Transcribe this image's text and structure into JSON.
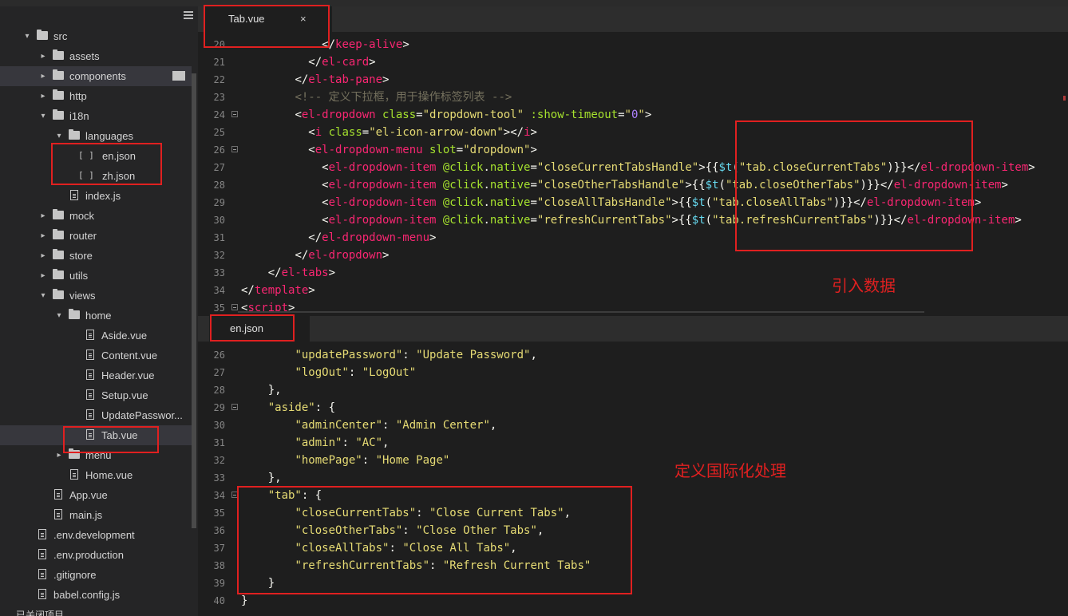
{
  "sidebar": {
    "items": [
      {
        "label": "src",
        "indent": 0,
        "type": "folder",
        "open": true
      },
      {
        "label": "assets",
        "indent": 1,
        "type": "folder",
        "open": false
      },
      {
        "label": "components",
        "indent": 1,
        "type": "folder",
        "open": false,
        "highlighted": true
      },
      {
        "label": "http",
        "indent": 1,
        "type": "folder",
        "open": false
      },
      {
        "label": "i18n",
        "indent": 1,
        "type": "folder",
        "open": true
      },
      {
        "label": "languages",
        "indent": 2,
        "type": "folder",
        "open": true
      },
      {
        "label": "en.json",
        "indent": 3,
        "type": "json"
      },
      {
        "label": "zh.json",
        "indent": 3,
        "type": "json"
      },
      {
        "label": "index.js",
        "indent": 2,
        "type": "file"
      },
      {
        "label": "mock",
        "indent": 1,
        "type": "folder",
        "open": false
      },
      {
        "label": "router",
        "indent": 1,
        "type": "folder",
        "open": false
      },
      {
        "label": "store",
        "indent": 1,
        "type": "folder",
        "open": false
      },
      {
        "label": "utils",
        "indent": 1,
        "type": "folder",
        "open": false
      },
      {
        "label": "views",
        "indent": 1,
        "type": "folder",
        "open": true
      },
      {
        "label": "home",
        "indent": 2,
        "type": "folder",
        "open": true
      },
      {
        "label": "Aside.vue",
        "indent": 3,
        "type": "file"
      },
      {
        "label": "Content.vue",
        "indent": 3,
        "type": "file"
      },
      {
        "label": "Header.vue",
        "indent": 3,
        "type": "file"
      },
      {
        "label": "Setup.vue",
        "indent": 3,
        "type": "file"
      },
      {
        "label": "UpdatePasswor...",
        "indent": 3,
        "type": "file"
      },
      {
        "label": "Tab.vue",
        "indent": 3,
        "type": "file",
        "selected": true
      },
      {
        "label": "menu",
        "indent": 2,
        "type": "folder",
        "open": false
      },
      {
        "label": "Home.vue",
        "indent": 2,
        "type": "file"
      },
      {
        "label": "App.vue",
        "indent": 1,
        "type": "file"
      },
      {
        "label": "main.js",
        "indent": 1,
        "type": "file"
      },
      {
        "label": ".env.development",
        "indent": 0,
        "type": "file"
      },
      {
        "label": ".env.production",
        "indent": 0,
        "type": "file"
      },
      {
        "label": ".gitignore",
        "indent": 0,
        "type": "file"
      },
      {
        "label": "babel.config.js",
        "indent": 0,
        "type": "file"
      }
    ],
    "footer": "已关闭项目"
  },
  "editor1": {
    "tab_label": "Tab.vue",
    "close_glyph": "×",
    "lines": [
      {
        "n": "20",
        "fold": false,
        "parts": [
          [
            "            ",
            "pun"
          ],
          [
            "</",
            "pun"
          ],
          [
            "keep-alive",
            "tag"
          ],
          [
            ">",
            "pun"
          ]
        ]
      },
      {
        "n": "21",
        "fold": false,
        "parts": [
          [
            "          ",
            "pun"
          ],
          [
            "</",
            "pun"
          ],
          [
            "el-card",
            "tag"
          ],
          [
            ">",
            "pun"
          ]
        ]
      },
      {
        "n": "22",
        "fold": false,
        "parts": [
          [
            "        ",
            "pun"
          ],
          [
            "</",
            "pun"
          ],
          [
            "el-tab-pane",
            "tag"
          ],
          [
            ">",
            "pun"
          ]
        ]
      },
      {
        "n": "23",
        "fold": false,
        "parts": [
          [
            "        ",
            "pun"
          ],
          [
            "<!-- 定义下拉框，用于操作标签列表 -->",
            "cm"
          ]
        ]
      },
      {
        "n": "24",
        "fold": true,
        "parts": [
          [
            "        ",
            "pun"
          ],
          [
            "<",
            "pun"
          ],
          [
            "el-dropdown",
            "tag"
          ],
          [
            " class",
            "attr"
          ],
          [
            "=",
            "pun"
          ],
          [
            "\"dropdown-tool\"",
            "str"
          ],
          [
            " :show-timeout",
            "attr"
          ],
          [
            "=",
            "pun"
          ],
          [
            "\"",
            "str"
          ],
          [
            "0",
            "num"
          ],
          [
            "\"",
            "str"
          ],
          [
            ">",
            "pun"
          ]
        ]
      },
      {
        "n": "25",
        "fold": false,
        "parts": [
          [
            "          ",
            "pun"
          ],
          [
            "<",
            "pun"
          ],
          [
            "i",
            "tag"
          ],
          [
            " class",
            "attr"
          ],
          [
            "=",
            "pun"
          ],
          [
            "\"el-icon-arrow-down\"",
            "str"
          ],
          [
            "></",
            "pun"
          ],
          [
            "i",
            "tag"
          ],
          [
            ">",
            "pun"
          ]
        ]
      },
      {
        "n": "26",
        "fold": true,
        "parts": [
          [
            "          ",
            "pun"
          ],
          [
            "<",
            "pun"
          ],
          [
            "el-dropdown-menu",
            "tag"
          ],
          [
            " slot",
            "attr"
          ],
          [
            "=",
            "pun"
          ],
          [
            "\"dropdown\"",
            "str"
          ],
          [
            ">",
            "pun"
          ]
        ]
      },
      {
        "n": "27",
        "fold": false,
        "parts": [
          [
            "            ",
            "pun"
          ],
          [
            "<",
            "pun"
          ],
          [
            "el-dropdown-item",
            "tag"
          ],
          [
            " @click",
            "attr"
          ],
          [
            ".",
            "pun"
          ],
          [
            "native",
            "attr"
          ],
          [
            "=",
            "pun"
          ],
          [
            "\"closeCurrentTabsHandle\"",
            "str"
          ],
          [
            ">{{",
            "pun"
          ],
          [
            "$t",
            "fn"
          ],
          [
            "(",
            "pun"
          ],
          [
            "\"tab.closeCurrentTabs\"",
            "str"
          ],
          [
            ")}}</",
            "pun"
          ],
          [
            "el-dropdown-item",
            "tag"
          ],
          [
            ">",
            "pun"
          ]
        ]
      },
      {
        "n": "28",
        "fold": false,
        "parts": [
          [
            "            ",
            "pun"
          ],
          [
            "<",
            "pun"
          ],
          [
            "el-dropdown-item",
            "tag"
          ],
          [
            " @click",
            "attr"
          ],
          [
            ".",
            "pun"
          ],
          [
            "native",
            "attr"
          ],
          [
            "=",
            "pun"
          ],
          [
            "\"closeOtherTabsHandle\"",
            "str"
          ],
          [
            ">{{",
            "pun"
          ],
          [
            "$t",
            "fn"
          ],
          [
            "(",
            "pun"
          ],
          [
            "\"tab.closeOtherTabs\"",
            "str"
          ],
          [
            ")}}</",
            "pun"
          ],
          [
            "el-dropdown-item",
            "tag"
          ],
          [
            ">",
            "pun"
          ]
        ]
      },
      {
        "n": "29",
        "fold": false,
        "parts": [
          [
            "            ",
            "pun"
          ],
          [
            "<",
            "pun"
          ],
          [
            "el-dropdown-item",
            "tag"
          ],
          [
            " @click",
            "attr"
          ],
          [
            ".",
            "pun"
          ],
          [
            "native",
            "attr"
          ],
          [
            "=",
            "pun"
          ],
          [
            "\"closeAllTabsHandle\"",
            "str"
          ],
          [
            ">{{",
            "pun"
          ],
          [
            "$t",
            "fn"
          ],
          [
            "(",
            "pun"
          ],
          [
            "\"tab.closeAllTabs\"",
            "str"
          ],
          [
            ")}}</",
            "pun"
          ],
          [
            "el-dropdown-item",
            "tag"
          ],
          [
            ">",
            "pun"
          ]
        ]
      },
      {
        "n": "30",
        "fold": false,
        "parts": [
          [
            "            ",
            "pun"
          ],
          [
            "<",
            "pun"
          ],
          [
            "el-dropdown-item",
            "tag"
          ],
          [
            " @click",
            "attr"
          ],
          [
            ".",
            "pun"
          ],
          [
            "native",
            "attr"
          ],
          [
            "=",
            "pun"
          ],
          [
            "\"refreshCurrentTabs\"",
            "str"
          ],
          [
            ">{{",
            "pun"
          ],
          [
            "$t",
            "fn"
          ],
          [
            "(",
            "pun"
          ],
          [
            "\"tab.refreshCurrentTabs\"",
            "str"
          ],
          [
            ")}}</",
            "pun"
          ],
          [
            "el-dropdown-item",
            "tag"
          ],
          [
            ">",
            "pun"
          ]
        ]
      },
      {
        "n": "31",
        "fold": false,
        "parts": [
          [
            "          ",
            "pun"
          ],
          [
            "</",
            "pun"
          ],
          [
            "el-dropdown-menu",
            "tag"
          ],
          [
            ">",
            "pun"
          ]
        ]
      },
      {
        "n": "32",
        "fold": false,
        "parts": [
          [
            "        ",
            "pun"
          ],
          [
            "</",
            "pun"
          ],
          [
            "el-dropdown",
            "tag"
          ],
          [
            ">",
            "pun"
          ]
        ]
      },
      {
        "n": "33",
        "fold": false,
        "parts": [
          [
            "    ",
            "pun"
          ],
          [
            "</",
            "pun"
          ],
          [
            "el-tabs",
            "tag"
          ],
          [
            ">",
            "pun"
          ]
        ]
      },
      {
        "n": "34",
        "fold": false,
        "parts": [
          [
            "</",
            "pun"
          ],
          [
            "template",
            "tag"
          ],
          [
            ">",
            "pun"
          ]
        ]
      },
      {
        "n": "35",
        "fold": true,
        "parts": [
          [
            "<",
            "pun"
          ],
          [
            "script",
            "tag"
          ],
          [
            ">",
            "pun"
          ]
        ]
      }
    ]
  },
  "editor2": {
    "tab_label": "en.json",
    "lines": [
      {
        "n": "26",
        "fold": false,
        "parts": [
          [
            "        ",
            "pun"
          ],
          [
            "\"updatePassword\"",
            "str"
          ],
          [
            ": ",
            "pun"
          ],
          [
            "\"Update Password\"",
            "str"
          ],
          [
            ",",
            "pun"
          ]
        ]
      },
      {
        "n": "27",
        "fold": false,
        "parts": [
          [
            "        ",
            "pun"
          ],
          [
            "\"logOut\"",
            "str"
          ],
          [
            ": ",
            "pun"
          ],
          [
            "\"LogOut\"",
            "str"
          ]
        ]
      },
      {
        "n": "28",
        "fold": false,
        "parts": [
          [
            "    ",
            "pun"
          ],
          [
            "},",
            "pun"
          ]
        ]
      },
      {
        "n": "29",
        "fold": true,
        "parts": [
          [
            "    ",
            "pun"
          ],
          [
            "\"aside\"",
            "str"
          ],
          [
            ": {",
            "pun"
          ]
        ]
      },
      {
        "n": "30",
        "fold": false,
        "parts": [
          [
            "        ",
            "pun"
          ],
          [
            "\"adminCenter\"",
            "str"
          ],
          [
            ": ",
            "pun"
          ],
          [
            "\"Admin Center\"",
            "str"
          ],
          [
            ",",
            "pun"
          ]
        ]
      },
      {
        "n": "31",
        "fold": false,
        "parts": [
          [
            "        ",
            "pun"
          ],
          [
            "\"admin\"",
            "str"
          ],
          [
            ": ",
            "pun"
          ],
          [
            "\"AC\"",
            "str"
          ],
          [
            ",",
            "pun"
          ]
        ]
      },
      {
        "n": "32",
        "fold": false,
        "parts": [
          [
            "        ",
            "pun"
          ],
          [
            "\"homePage\"",
            "str"
          ],
          [
            ": ",
            "pun"
          ],
          [
            "\"Home Page\"",
            "str"
          ]
        ]
      },
      {
        "n": "33",
        "fold": false,
        "parts": [
          [
            "    ",
            "pun"
          ],
          [
            "},",
            "pun"
          ]
        ]
      },
      {
        "n": "34",
        "fold": true,
        "parts": [
          [
            "    ",
            "pun"
          ],
          [
            "\"tab\"",
            "str"
          ],
          [
            ": {",
            "pun"
          ]
        ]
      },
      {
        "n": "35",
        "fold": false,
        "parts": [
          [
            "        ",
            "pun"
          ],
          [
            "\"closeCurrentTabs\"",
            "str"
          ],
          [
            ": ",
            "pun"
          ],
          [
            "\"Close Current Tabs\"",
            "str"
          ],
          [
            ",",
            "pun"
          ]
        ]
      },
      {
        "n": "36",
        "fold": false,
        "parts": [
          [
            "        ",
            "pun"
          ],
          [
            "\"closeOtherTabs\"",
            "str"
          ],
          [
            ": ",
            "pun"
          ],
          [
            "\"Close Other Tabs\"",
            "str"
          ],
          [
            ",",
            "pun"
          ]
        ]
      },
      {
        "n": "37",
        "fold": false,
        "parts": [
          [
            "        ",
            "pun"
          ],
          [
            "\"closeAllTabs\"",
            "str"
          ],
          [
            ": ",
            "pun"
          ],
          [
            "\"Close All Tabs\"",
            "str"
          ],
          [
            ",",
            "pun"
          ]
        ]
      },
      {
        "n": "38",
        "fold": false,
        "parts": [
          [
            "        ",
            "pun"
          ],
          [
            "\"refreshCurrentTabs\"",
            "str"
          ],
          [
            ": ",
            "pun"
          ],
          [
            "\"Refresh Current Tabs\"",
            "str"
          ]
        ]
      },
      {
        "n": "39",
        "fold": false,
        "parts": [
          [
            "    ",
            "pun"
          ],
          [
            "}",
            "pun"
          ]
        ]
      },
      {
        "n": "40",
        "fold": false,
        "parts": [
          [
            "}",
            "pun"
          ]
        ]
      }
    ]
  },
  "annotations": {
    "import_data": "引入数据",
    "define_i18n": "定义国际化处理"
  },
  "colors": {
    "annotation_red": "#e02020",
    "tag": "#f92672",
    "attr": "#a6e22e",
    "string": "#e6db74",
    "comment": "#75715e"
  }
}
